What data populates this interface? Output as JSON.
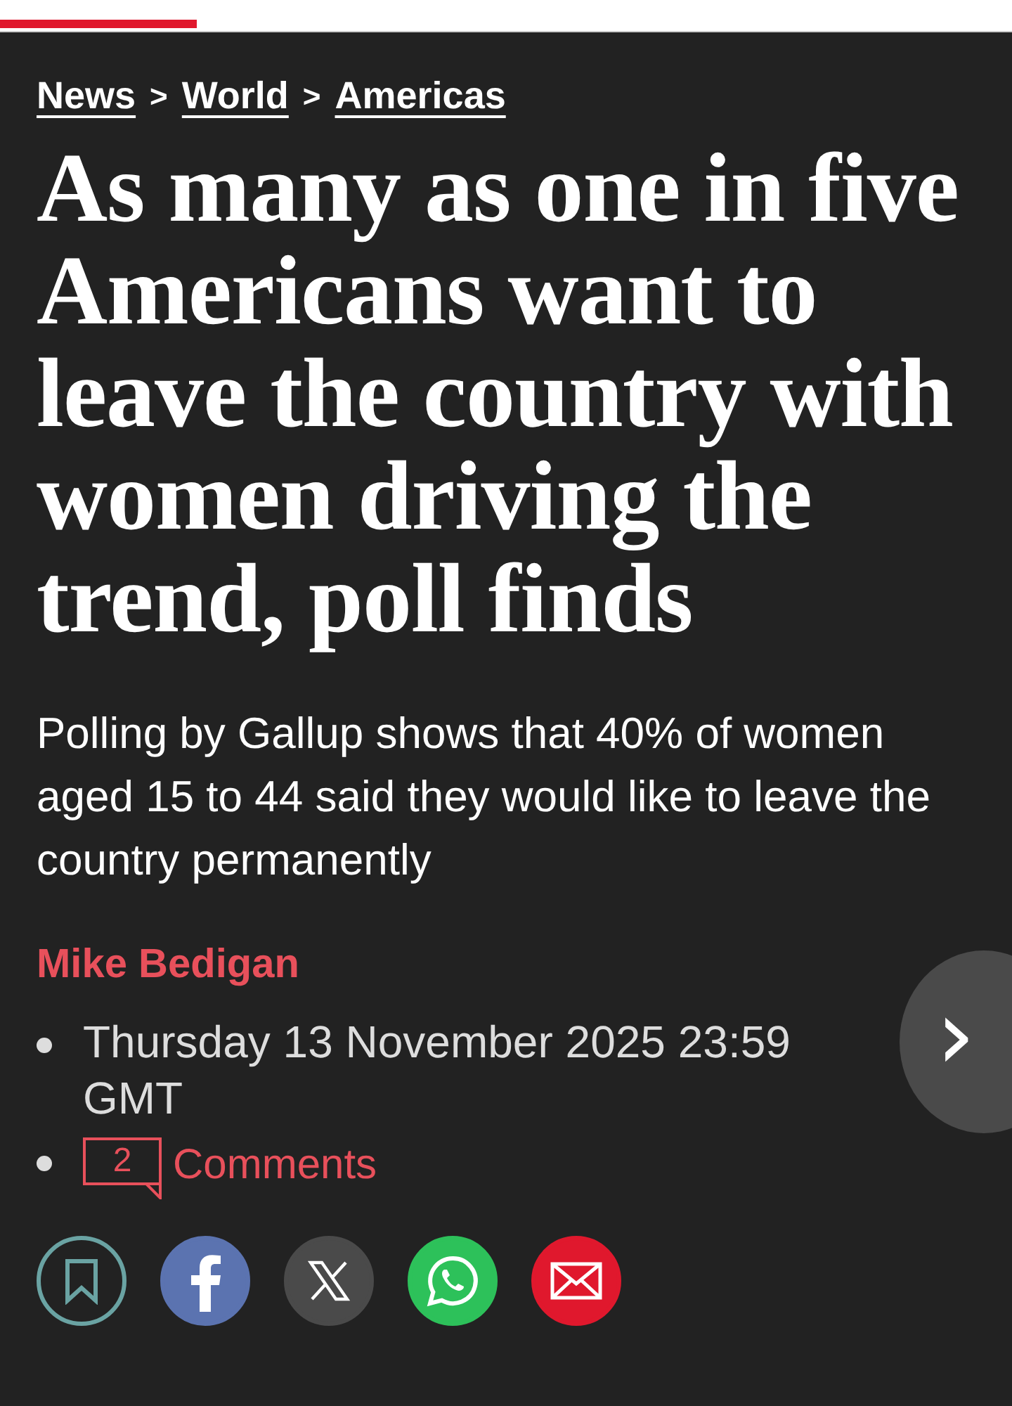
{
  "reading_progress": {
    "level": 0.195
  },
  "breadcrumb": [
    "News",
    "World",
    "Americas"
  ],
  "breadcrumb_separator": ">",
  "headline": "As many as one in five Americans want to leave the country with women driving the trend, poll finds",
  "standfirst": "Polling by Gallup shows that 40% of women aged 15 to 44 said they would like to leave the country permanently",
  "author": "Mike Bedigan",
  "meta": [
    {
      "kind": "date",
      "text": "Thursday 13 November 2025 23:59 GMT"
    },
    {
      "kind": "comments",
      "count": "2",
      "text": "Comments"
    }
  ],
  "next_button": {
    "label": "›"
  },
  "share": [
    {
      "kind": "bookmark"
    },
    {
      "kind": "facebook"
    },
    {
      "kind": "x"
    },
    {
      "kind": "whatsapp"
    },
    {
      "kind": "email"
    }
  ]
}
